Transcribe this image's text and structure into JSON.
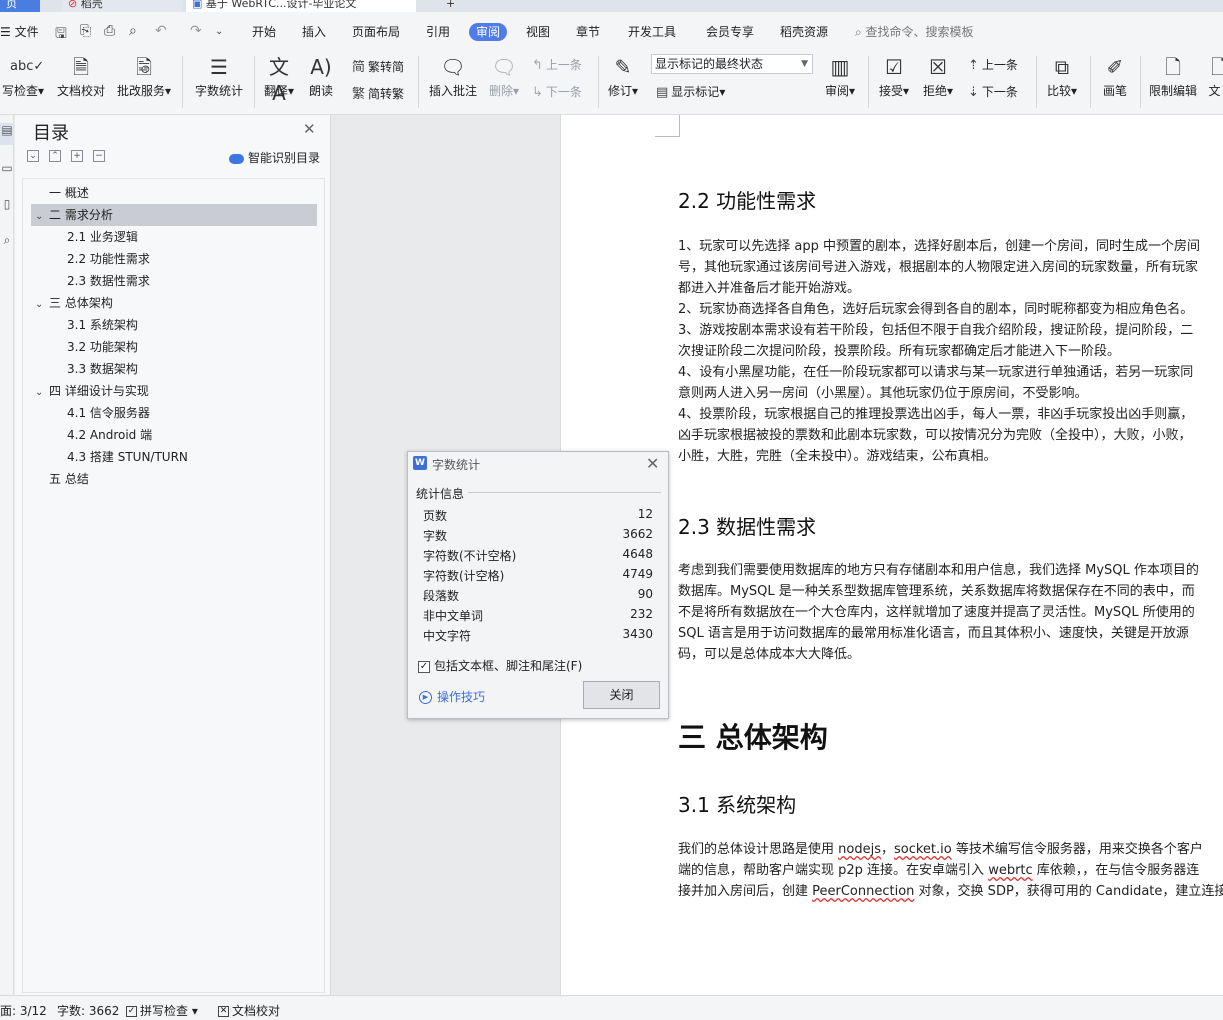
{
  "tabs": {
    "home": "页",
    "daoke": "稻壳",
    "doc": "基于 WebRTC...设计-毕业论文",
    "add": "+"
  },
  "menu": {
    "file": "文件",
    "items": [
      "开始",
      "插入",
      "页面布局",
      "引用",
      "审阅",
      "视图",
      "章节",
      "开发工具",
      "会员专享",
      "稻壳资源"
    ],
    "active": "审阅",
    "search_placeholder": "查找命令、搜索模板"
  },
  "ribbon": {
    "spellcheck": "写检查",
    "doc_proof": "文档校对",
    "revise_service": "批改服务",
    "word_count": "字数统计",
    "translate": "翻译",
    "read_aloud": "朗读",
    "trad_to_simp": "繁转简",
    "simp_to_trad": "简转繁",
    "insert_comment": "插入批注",
    "delete": "删除",
    "prev_comment": "上一条",
    "next_comment": "下一条",
    "track_changes": "修订",
    "markup_state": "显示标记的最终状态",
    "show_markup": "显示标记",
    "review_pane": "审阅",
    "accept": "接受",
    "reject": "拒绝",
    "prev_change": "上一条",
    "next_change": "下一条",
    "compare": "比较",
    "ink": "画笔",
    "restrict_edit": "限制编辑",
    "doc_right": "文"
  },
  "navpane": {
    "title": "目录",
    "smart_toc": "智能识别目录",
    "items": [
      {
        "label": "一 概述",
        "level": 1,
        "arrow": ""
      },
      {
        "label": "二 需求分析",
        "level": 1,
        "arrow": "v",
        "selected": true
      },
      {
        "label": "2.1  业务逻辑",
        "level": 2,
        "arrow": ""
      },
      {
        "label": "2.2  功能性需求",
        "level": 2,
        "arrow": ""
      },
      {
        "label": "2.3  数据性需求",
        "level": 2,
        "arrow": ""
      },
      {
        "label": "三 总体架构",
        "level": 1,
        "arrow": "v"
      },
      {
        "label": "3.1  系统架构",
        "level": 2,
        "arrow": ""
      },
      {
        "label": "3.2  功能架构",
        "level": 2,
        "arrow": ""
      },
      {
        "label": "3.3  数据架构",
        "level": 2,
        "arrow": ""
      },
      {
        "label": "四 详细设计与实现",
        "level": 1,
        "arrow": "v"
      },
      {
        "label": "4.1  信令服务器",
        "level": 2,
        "arrow": ""
      },
      {
        "label": "4.2 Android 端",
        "level": 2,
        "arrow": ""
      },
      {
        "label": "4.3  搭建  STUN/TURN",
        "level": 2,
        "arrow": ""
      },
      {
        "label": "五 总结",
        "level": 1,
        "arrow": ""
      }
    ]
  },
  "document": {
    "h_2_2": "2.2  功能性需求",
    "p_2_2": [
      "1、玩家可以先选择 app 中预置的剧本，选择好剧本后，创建一个房间，同时生成一个房间",
      "号，其他玩家通过该房间号进入游戏，根据剧本的人物限定进入房间的玩家数量，所有玩家",
      "都进入并准备后才能开始游戏。",
      "2、玩家协商选择各自角色，选好后玩家会得到各自的剧本，同时昵称都变为相应角色名。",
      "3、游戏按剧本需求设有若干阶段，包括但不限于自我介绍阶段，搜证阶段，提问阶段，二",
      "次搜证阶段二次提问阶段，投票阶段。所有玩家都确定后才能进入下一阶段。",
      "4、设有小黑屋功能，在任一阶段玩家都可以请求与某一玩家进行单独通话，若另一玩家同",
      "意则两人进入另一房间（小黑屋）。其他玩家仍位于原房间，不受影响。",
      "4、投票阶段，玩家根据自己的推理投票选出凶手，每人一票，非凶手玩家投出凶手则赢，",
      "凶手玩家根据被投的票数和此剧本玩家数，可以按情况分为完败（全投中），大败，小败，",
      "小胜，大胜，完胜（全未投中）。游戏结束，公布真相。"
    ],
    "h_2_3": "2.3  数据性需求",
    "p_2_3": [
      "考虑到我们需要使用数据库的地方只有存储剧本和用户信息，我们选择 MySQL 作本项目的",
      "数据库。MySQL 是一种关系型数据库管理系统，关系数据库将数据保存在不同的表中，而",
      "不是将所有数据放在一个大仓库内，这样就增加了速度并提高了灵活性。MySQL 所使用的",
      "SQL 语言是用于访问数据库的最常用标准化语言，而且其体积小、速度快，关键是开放源",
      "码，可以是总体成本大大降低。"
    ],
    "h1_3": "三  总体架构",
    "h_3_1": "3.1  系统架构",
    "p_3_1_line1_a": "我们的总体设计思路是使用 ",
    "p_3_1_line1_b": "nodejs",
    "p_3_1_line1_c": "，",
    "p_3_1_line1_d": "socket.io",
    "p_3_1_line1_e": " 等技术编写信令服务器，用来交换各个客户",
    "p_3_1_line2_a": "端的信息，帮助客户端实现 p2p 连接。在安卓端引入 ",
    "p_3_1_line2_b": "webrtc",
    "p_3_1_line2_c": " 库依赖，，在与信令服务器连",
    "p_3_1_line3_a": "接并加入房间后，创建 ",
    "p_3_1_line3_b": "PeerConnection",
    "p_3_1_line3_c": " 对象，交换 SDP，获得可用的 Candidate，建立连接"
  },
  "dialog": {
    "title": "字数统计",
    "section": "统计信息",
    "rows": [
      {
        "label": "页数",
        "value": "12"
      },
      {
        "label": "字数",
        "value": "3662"
      },
      {
        "label": "字符数(不计空格)",
        "value": "4648"
      },
      {
        "label": "字符数(计空格)",
        "value": "4749"
      },
      {
        "label": "段落数",
        "value": "90"
      },
      {
        "label": "非中文单词",
        "value": "232"
      },
      {
        "label": "中文字符",
        "value": "3430"
      }
    ],
    "checkbox_label": "包括文本框、脚注和尾注(F)",
    "checkbox_checked": true,
    "tips": "操作技巧",
    "close_button": "关闭"
  },
  "statusbar": {
    "page": "面: 3/12",
    "words": "字数: 3662",
    "spellcheck": "拼写检查",
    "doc_proof": "文档校对"
  },
  "colors": {
    "accent": "#4f7ce8",
    "link": "#3c6fd6",
    "spell_underline": "#dd3333"
  }
}
